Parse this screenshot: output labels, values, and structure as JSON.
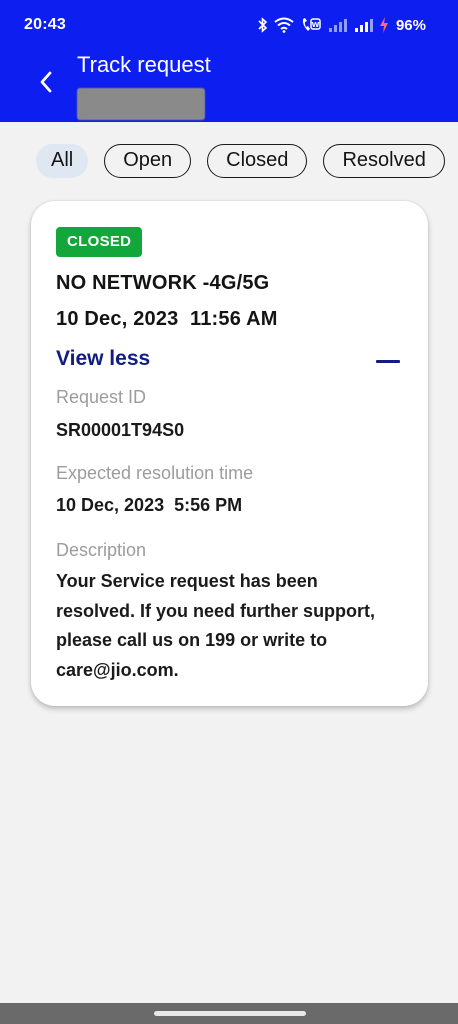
{
  "status_bar": {
    "time": "20:43",
    "battery": "96%",
    "icons": [
      "bluetooth-icon",
      "wifi-icon",
      "volte-call-icon",
      "signal-icon",
      "signal-icon",
      "charging-icon"
    ]
  },
  "header": {
    "title": "Track request",
    "back_icon": "chevron-left-icon"
  },
  "filters": {
    "chips": [
      "All",
      "Open",
      "Closed",
      "Resolved"
    ],
    "selected": "All"
  },
  "request_card": {
    "status_badge": "CLOSED",
    "status_color": "#12a63b",
    "title": "NO NETWORK -4G/5G",
    "date": "10 Dec, 2023  11:56 AM",
    "toggle_label": "View less",
    "toggle_icon": "minus-icon",
    "request_id_label": "Request ID",
    "request_id": "SR00001T94S0",
    "expected_label": "Expected resolution time",
    "expected_time": "10 Dec, 2023  5:56 PM",
    "description_label": "Description",
    "description": "Your Service request has been resolved. If you need further support, please call us on 199 or write to care@jio.com."
  },
  "colors": {
    "brand": "#0d1ff0",
    "link": "#0f1e80",
    "background": "#f2f2f2"
  }
}
